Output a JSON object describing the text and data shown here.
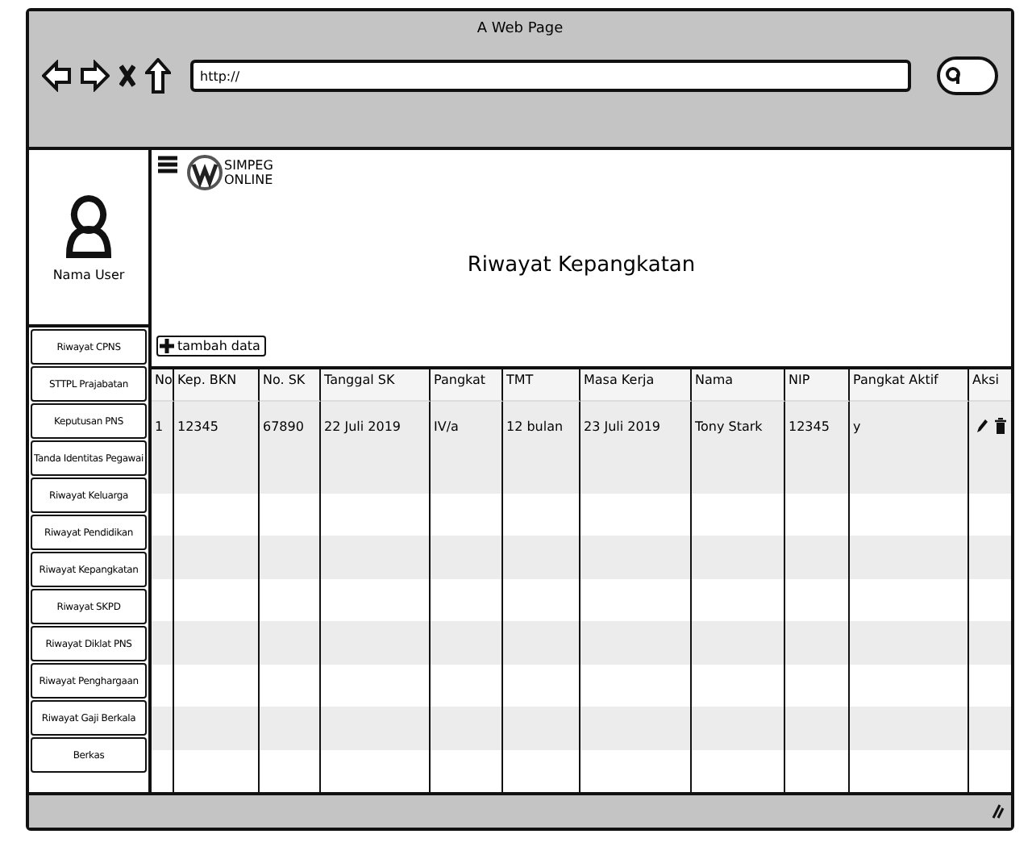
{
  "window": {
    "title": "A Web Page"
  },
  "browser": {
    "url": "http://"
  },
  "header": {
    "logo_line_1": "SIMPEG",
    "logo_line_2": "ONLINE",
    "page_title": "Riwayat Kepangkatan"
  },
  "user": {
    "name": "Nama User"
  },
  "sidebar": {
    "items": [
      {
        "label": "Riwayat CPNS"
      },
      {
        "label": "STTPL Prajabatan"
      },
      {
        "label": "Keputusan PNS"
      },
      {
        "label": "Tanda Identitas Pegawai"
      },
      {
        "label": "Riwayat Keluarga"
      },
      {
        "label": "Riwayat Pendidikan"
      },
      {
        "label": "Riwayat Kepangkatan"
      },
      {
        "label": "Riwayat SKPD"
      },
      {
        "label": "Riwayat Diklat PNS"
      },
      {
        "label": "Riwayat Penghargaan"
      },
      {
        "label": "Riwayat Gaji Berkala"
      },
      {
        "label": "Berkas"
      }
    ]
  },
  "add_button": {
    "label": "tambah data"
  },
  "table": {
    "columns": [
      "No",
      "Kep. BKN",
      "No. SK",
      "Tanggal SK",
      "Pangkat",
      "TMT",
      "Masa Kerja",
      "Nama",
      "NIP",
      "Pangkat Aktif",
      "Aksi"
    ],
    "rows": [
      {
        "cells": [
          "1",
          "12345",
          "67890",
          "22 Juli 2019",
          "IV/a",
          "12 bulan",
          "23 Juli 2019",
          "Tony Stark",
          "12345",
          "y"
        ]
      }
    ]
  }
}
